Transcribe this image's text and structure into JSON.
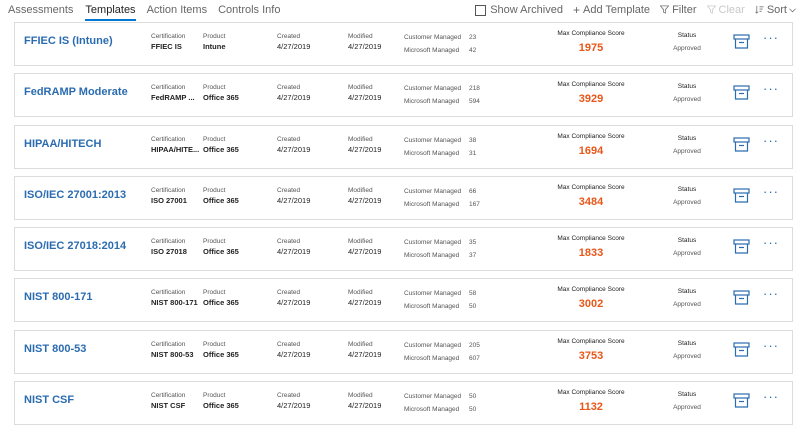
{
  "tabs": [
    {
      "label": "Assessments",
      "active": false
    },
    {
      "label": "Templates",
      "active": true
    },
    {
      "label": "Action Items",
      "active": false
    },
    {
      "label": "Controls Info",
      "active": false
    }
  ],
  "toolbar": {
    "show_archived": "Show Archived",
    "add_template": "Add Template",
    "filter": "Filter",
    "clear": "Clear",
    "sort": "Sort"
  },
  "labels": {
    "certification": "Certification",
    "product": "Product",
    "created": "Created",
    "modified": "Modified",
    "customer_managed": "Customer Managed",
    "microsoft_managed": "Microsoft Managed",
    "max_score": "Max Compliance Score",
    "status": "Status",
    "more": "···"
  },
  "colors": {
    "accent": "#0078d4",
    "link": "#2b6cb0",
    "score": "#e8571a"
  },
  "templates": [
    {
      "name": "FFIEC IS (Intune)",
      "certification": "FFIEC IS",
      "product": "Intune",
      "created": "4/27/2019",
      "modified": "4/27/2019",
      "customer_managed": "23",
      "microsoft_managed": "42",
      "score": "1975",
      "status": "Approved"
    },
    {
      "name": "FedRAMP Moderate",
      "certification": "FedRAMP ...",
      "product": "Office 365",
      "created": "4/27/2019",
      "modified": "4/27/2019",
      "customer_managed": "218",
      "microsoft_managed": "594",
      "score": "3929",
      "status": "Approved"
    },
    {
      "name": "HIPAA/HITECH",
      "certification": "HIPAA/HITE...",
      "product": "Office 365",
      "created": "4/27/2019",
      "modified": "4/27/2019",
      "customer_managed": "38",
      "microsoft_managed": "31",
      "score": "1694",
      "status": "Approved"
    },
    {
      "name": "ISO/IEC 27001:2013",
      "certification": "ISO 27001",
      "product": "Office 365",
      "created": "4/27/2019",
      "modified": "4/27/2019",
      "customer_managed": "66",
      "microsoft_managed": "167",
      "score": "3484",
      "status": "Approved"
    },
    {
      "name": "ISO/IEC 27018:2014",
      "certification": "ISO 27018",
      "product": "Office 365",
      "created": "4/27/2019",
      "modified": "4/27/2019",
      "customer_managed": "35",
      "microsoft_managed": "37",
      "score": "1833",
      "status": "Approved"
    },
    {
      "name": "NIST 800-171",
      "certification": "NIST 800-171",
      "product": "Office 365",
      "created": "4/27/2019",
      "modified": "4/27/2019",
      "customer_managed": "58",
      "microsoft_managed": "50",
      "score": "3002",
      "status": "Approved"
    },
    {
      "name": "NIST 800-53",
      "certification": "NIST 800-53",
      "product": "Office 365",
      "created": "4/27/2019",
      "modified": "4/27/2019",
      "customer_managed": "205",
      "microsoft_managed": "607",
      "score": "3753",
      "status": "Approved"
    },
    {
      "name": "NIST CSF",
      "certification": "NIST CSF",
      "product": "Office 365",
      "created": "4/27/2019",
      "modified": "4/27/2019",
      "customer_managed": "50",
      "microsoft_managed": "50",
      "score": "1132",
      "status": "Approved"
    }
  ]
}
